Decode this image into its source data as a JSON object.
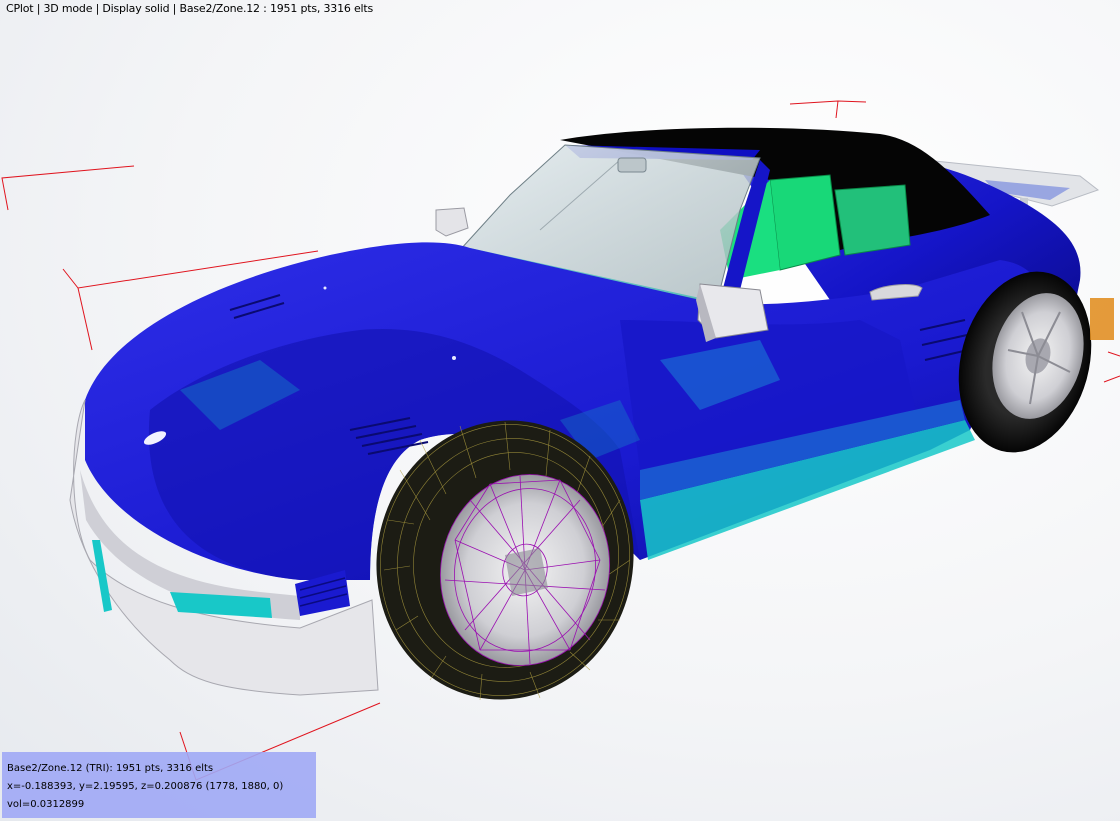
{
  "window": {
    "status_line": "CPlot | 3D mode | Display solid | Base2/Zone.12 : 1951 pts, 3316 elts"
  },
  "info_panel": {
    "zone_line": "Base2/Zone.12 (TRI): 1951 pts, 3316 elts",
    "coords_line": "x=-0.188393, y=2.19595, z=0.200876 (1778, 1880,  0)",
    "vol_line": "vol=0.0312899"
  },
  "colors": {
    "body": "#1515c8",
    "body_shade": "#0b0b8a",
    "accent_cyan": "#18c8c8",
    "interior_green": "#18d878",
    "roof": "#050505",
    "bumper": "#e8e8ea",
    "mesh_wire": "#9a0fb0",
    "tire_wire": "#b0a040",
    "axis_red": "#e0141e",
    "info_bg": "#a0a8f5"
  },
  "icons": {
    "scene_axes": "axis-cross-icon"
  }
}
